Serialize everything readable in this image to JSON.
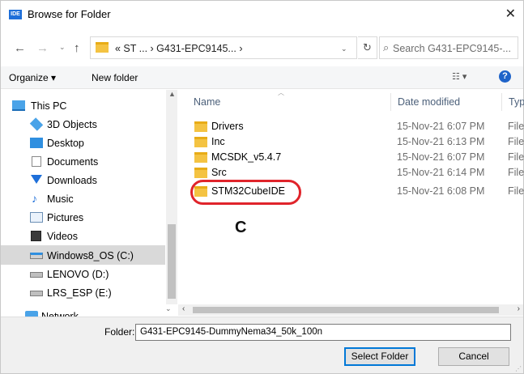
{
  "window": {
    "title": "Browse for Folder",
    "app_icon_text": "IDE",
    "close_glyph": "✕"
  },
  "nav": {
    "back_glyph": "←",
    "forward_glyph": "→",
    "recent_glyph": "⌄",
    "up_glyph": "↑",
    "address": "« ST ...  ›  G431-EPC9145...  ›",
    "address_dropdown_glyph": "⌄",
    "refresh_glyph": "↻",
    "search_placeholder": "Search G431-EPC9145-..."
  },
  "toolbar": {
    "organize_label": "Organize ▾",
    "new_folder_label": "New folder",
    "view_glyph": "☷ ▾",
    "help_glyph": "?"
  },
  "sidebar": {
    "items": [
      {
        "label": "This PC",
        "icon": "computer-icon"
      },
      {
        "label": "3D Objects",
        "icon": "cube-icon"
      },
      {
        "label": "Desktop",
        "icon": "desktop-icon"
      },
      {
        "label": "Documents",
        "icon": "document-icon"
      },
      {
        "label": "Downloads",
        "icon": "download-icon"
      },
      {
        "label": "Music",
        "icon": "music-icon"
      },
      {
        "label": "Pictures",
        "icon": "picture-icon"
      },
      {
        "label": "Videos",
        "icon": "video-icon"
      },
      {
        "label": "Windows8_OS (C:)",
        "icon": "drive-icon"
      },
      {
        "label": "LENOVO (D:)",
        "icon": "drive-icon"
      },
      {
        "label": "LRS_ESP (E:)",
        "icon": "drive-icon"
      },
      {
        "label": "Network",
        "icon": "network-icon"
      }
    ],
    "selected_index": 8
  },
  "filelist": {
    "columns": [
      "Name",
      "Date modified",
      "Typ"
    ],
    "rows": [
      {
        "name": "Drivers",
        "date": "15-Nov-21 6:07 PM",
        "type": "File"
      },
      {
        "name": "Inc",
        "date": "15-Nov-21 6:13 PM",
        "type": "File"
      },
      {
        "name": "MCSDK_v5.4.7",
        "date": "15-Nov-21 6:07 PM",
        "type": "File"
      },
      {
        "name": "Src",
        "date": "15-Nov-21 6:14 PM",
        "type": "File"
      },
      {
        "name": "STM32CubeIDE",
        "date": "15-Nov-21 6:08 PM",
        "type": "File"
      }
    ]
  },
  "annotation": {
    "label": "C",
    "color": "#e0242b"
  },
  "footer": {
    "folder_label": "Folder:",
    "folder_value": "G431-EPC9145-DummyNema34_50k_100n",
    "select_button": "Select Folder",
    "cancel_button": "Cancel"
  },
  "colors": {
    "accent": "#0078d7",
    "folder": "#f4c342",
    "selection": "#d9d9d9"
  }
}
